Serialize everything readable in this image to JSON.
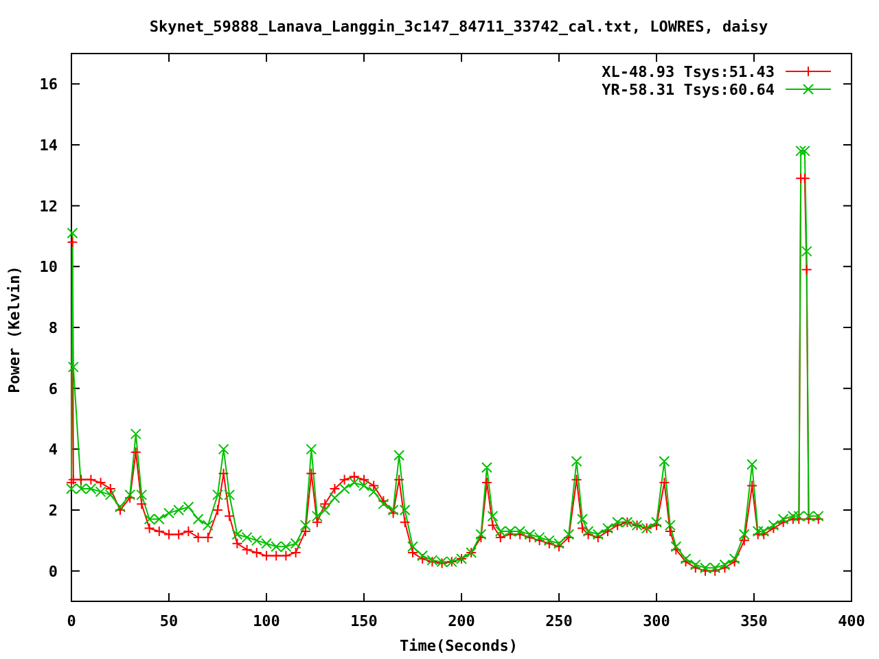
{
  "chart_data": {
    "type": "line",
    "title": "Skynet_59888_Lanava_Langgin_3c147_84711_33742_cal.txt, LOWRES, daisy",
    "xlabel": "Time(Seconds)",
    "ylabel": "Power (Kelvin)",
    "x": [
      0,
      0.5,
      1,
      5,
      10,
      15,
      20,
      25,
      30,
      33,
      36,
      40,
      45,
      50,
      55,
      60,
      65,
      70,
      75,
      78,
      81,
      85,
      90,
      95,
      100,
      105,
      110,
      115,
      120,
      123,
      126,
      130,
      135,
      140,
      145,
      150,
      155,
      160,
      165,
      168,
      171,
      175,
      180,
      185,
      190,
      195,
      200,
      205,
      210,
      213,
      216,
      220,
      225,
      230,
      235,
      240,
      245,
      250,
      255,
      259,
      262,
      265,
      270,
      275,
      280,
      285,
      290,
      295,
      300,
      304,
      307,
      310,
      315,
      320,
      325,
      330,
      335,
      340,
      345,
      349,
      352,
      355,
      360,
      365,
      370,
      373,
      374,
      376,
      377,
      378,
      383
    ],
    "series": [
      {
        "name": "XL-48.93 Tsys:51.43",
        "color": "#ff0000",
        "marker": "plus",
        "values": [
          2.9,
          10.8,
          3.0,
          3.0,
          3.0,
          2.9,
          2.7,
          2.0,
          2.4,
          3.9,
          2.2,
          1.4,
          1.3,
          1.2,
          1.2,
          1.3,
          1.1,
          1.1,
          2.0,
          3.2,
          1.8,
          0.9,
          0.7,
          0.6,
          0.5,
          0.5,
          0.5,
          0.6,
          1.3,
          3.2,
          1.6,
          2.2,
          2.7,
          3.0,
          3.1,
          3.0,
          2.8,
          2.3,
          1.9,
          3.0,
          1.6,
          0.6,
          0.4,
          0.3,
          0.25,
          0.3,
          0.4,
          0.6,
          1.1,
          2.9,
          1.5,
          1.1,
          1.2,
          1.2,
          1.1,
          1.0,
          0.9,
          0.8,
          1.1,
          3.0,
          1.4,
          1.2,
          1.1,
          1.3,
          1.5,
          1.6,
          1.5,
          1.4,
          1.5,
          2.9,
          1.3,
          0.7,
          0.3,
          0.1,
          0.0,
          0.0,
          0.1,
          0.3,
          1.0,
          2.8,
          1.2,
          1.2,
          1.4,
          1.6,
          1.7,
          1.7,
          12.9,
          12.9,
          9.9,
          1.7,
          1.7
        ]
      },
      {
        "name": "YR-58.31 Tsys:60.64",
        "color": "#00c000",
        "marker": "cross",
        "values": [
          2.7,
          11.1,
          6.7,
          2.7,
          2.7,
          2.6,
          2.5,
          2.1,
          2.5,
          4.5,
          2.5,
          1.7,
          1.7,
          1.9,
          2.0,
          2.1,
          1.7,
          1.5,
          2.5,
          4.0,
          2.5,
          1.2,
          1.1,
          1.0,
          0.9,
          0.8,
          0.8,
          0.9,
          1.5,
          4.0,
          1.8,
          2.0,
          2.4,
          2.7,
          2.9,
          2.8,
          2.6,
          2.2,
          2.0,
          3.8,
          2.0,
          0.8,
          0.5,
          0.35,
          0.3,
          0.3,
          0.4,
          0.6,
          1.2,
          3.4,
          1.8,
          1.3,
          1.3,
          1.3,
          1.2,
          1.1,
          1.0,
          0.9,
          1.2,
          3.6,
          1.7,
          1.3,
          1.2,
          1.4,
          1.6,
          1.6,
          1.5,
          1.4,
          1.6,
          3.6,
          1.5,
          0.8,
          0.4,
          0.2,
          0.1,
          0.1,
          0.2,
          0.4,
          1.2,
          3.5,
          1.3,
          1.3,
          1.5,
          1.7,
          1.8,
          1.8,
          13.8,
          13.8,
          10.5,
          1.8,
          1.8
        ]
      }
    ],
    "legend": true,
    "xlim": [
      0,
      400
    ],
    "ylim": [
      -1,
      17
    ],
    "xticks": [
      0,
      50,
      100,
      150,
      200,
      250,
      300,
      350,
      400
    ],
    "yticks": [
      0,
      2,
      4,
      6,
      8,
      10,
      12,
      14,
      16
    ]
  }
}
